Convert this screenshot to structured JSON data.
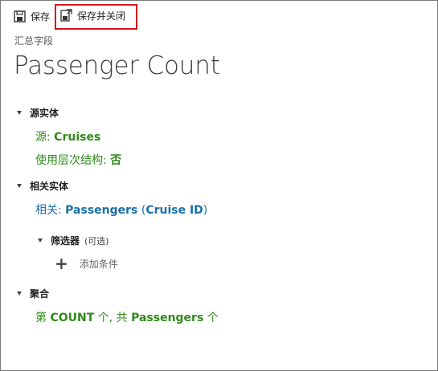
{
  "toolbar": {
    "save_label": "保存",
    "save_close_label": "保存并关闭"
  },
  "form": {
    "caption": "汇总字段",
    "title": "Passenger Count"
  },
  "source_section": {
    "header": "源实体",
    "source_label": "源:",
    "source_value": "Cruises",
    "hierarchy_label": "使用层次结构:",
    "hierarchy_value": "否"
  },
  "related_section": {
    "header": "相关实体",
    "related_label": "相关:",
    "related_entity": "Passengers",
    "open_paren": "(",
    "related_field": "Cruise ID",
    "close_paren": ")",
    "filter": {
      "label": "筛选器",
      "optional": "(可选)",
      "add_condition": "添加条件"
    }
  },
  "aggregate_section": {
    "header": "聚合",
    "prefix": "第",
    "function": "COUNT",
    "middle": "个, 共",
    "entity": "Passengers",
    "suffix": "个"
  },
  "colors": {
    "highlight": "#d6141c",
    "value_green": "#2f8a1a",
    "value_blue": "#1c6fa6"
  }
}
